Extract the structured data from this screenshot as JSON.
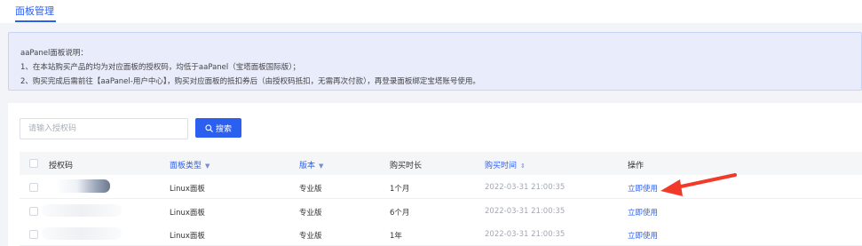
{
  "tabs": {
    "panel_manage": "面板管理"
  },
  "notice": {
    "title": "aaPanel面板说明：",
    "line1": "1、在本站购买产品的均为对应面板的授权码，均低于aaPanel（宝塔面板国际版）；",
    "line2": "2、购买完成后需前往【aaPanel-用户中心】，购买对应面板的抵扣券后（由授权码抵扣，无需再次付款），再登录面板绑定宝塔账号使用。"
  },
  "search": {
    "placeholder": "请输入授权码",
    "value": "",
    "button_label": "搜索"
  },
  "table": {
    "headers": {
      "code": "授权码",
      "panel_type": "面板类型",
      "version": "版本",
      "duration": "购买时长",
      "purchase_time": "购买时间",
      "action": "操作"
    },
    "rows": [
      {
        "panel_type": "Linux面板",
        "version": "专业版",
        "duration": "1个月",
        "purchase_time": "2022-03-31 21:00:35",
        "action": "立即使用"
      },
      {
        "panel_type": "Linux面板",
        "version": "专业版",
        "duration": "6个月",
        "purchase_time": "2022-03-31 21:00:35",
        "action": "立即使用"
      },
      {
        "panel_type": "Linux面板",
        "version": "专业版",
        "duration": "1年",
        "purchase_time": "2022-03-31 21:00:35",
        "action": "立即使用"
      }
    ]
  },
  "colors": {
    "accent": "#2b5ff0",
    "arrow": "#f23a2a",
    "notice_bg": "#e8ecfb"
  }
}
